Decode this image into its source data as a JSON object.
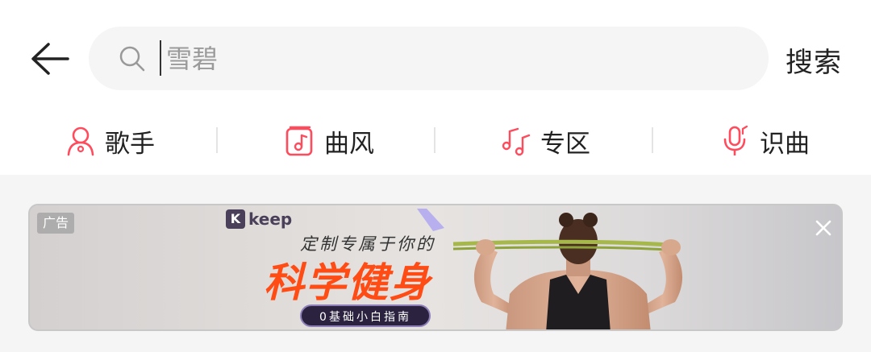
{
  "search": {
    "placeholder": "雪碧",
    "button_label": "搜索"
  },
  "categories": [
    {
      "label": "歌手",
      "icon": "singer-icon"
    },
    {
      "label": "曲风",
      "icon": "music-note-icon"
    },
    {
      "label": "专区",
      "icon": "music-notes-icon"
    },
    {
      "label": "识曲",
      "icon": "microphone-icon"
    }
  ],
  "ad": {
    "badge": "广告",
    "brand": "keep",
    "brand_letter": "K",
    "tagline": "定制专属于你的",
    "headline": "科学健身",
    "button": "0基础小白指南"
  },
  "colors": {
    "accent": "#ff4b5c",
    "headline": "#ff4b14",
    "brand": "#4a4059"
  }
}
